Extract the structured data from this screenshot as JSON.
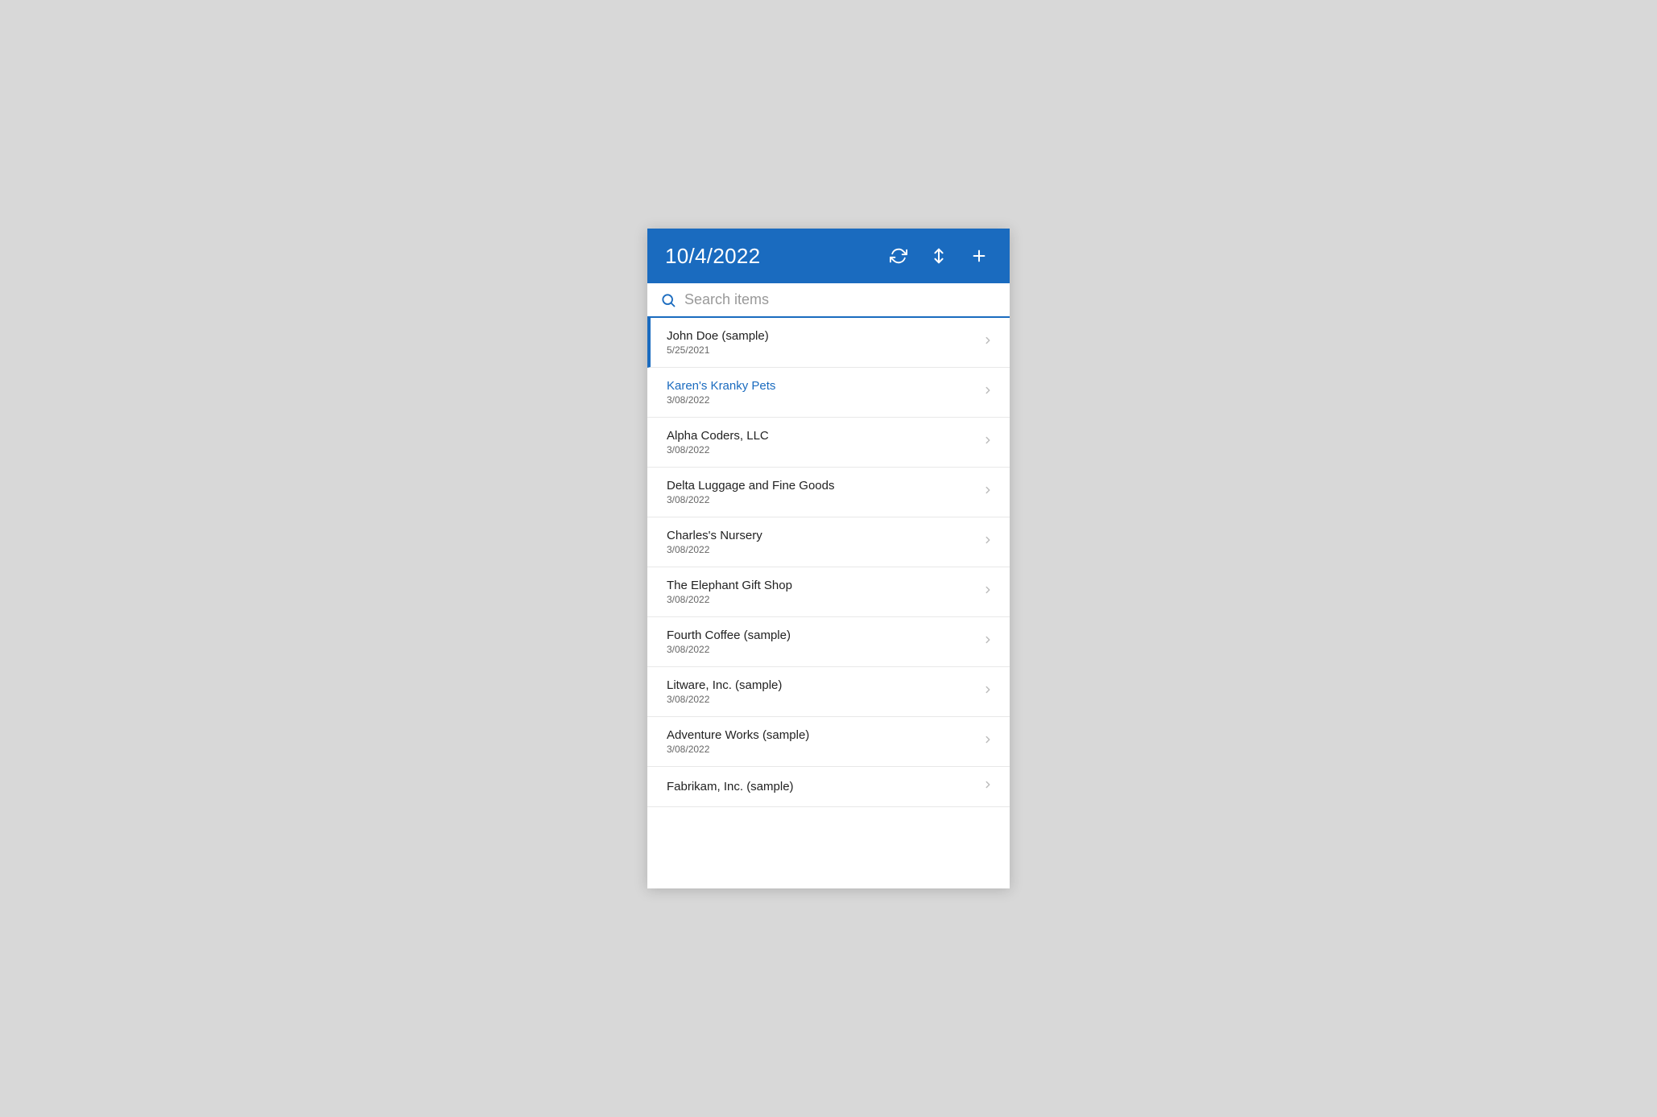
{
  "header": {
    "title": "10/4/2022",
    "refresh_icon": "↺",
    "sort_icon": "⇅",
    "add_icon": "+"
  },
  "search": {
    "placeholder": "Search items"
  },
  "colors": {
    "brand_blue": "#1a6bbf",
    "link_blue": "#1a6bbf"
  },
  "items": [
    {
      "id": 1,
      "name": "John Doe (sample)",
      "date": "5/25/2021",
      "selected": true,
      "link": false
    },
    {
      "id": 2,
      "name": "Karen's Kranky Pets",
      "date": "3/08/2022",
      "selected": false,
      "link": true
    },
    {
      "id": 3,
      "name": "Alpha Coders, LLC",
      "date": "3/08/2022",
      "selected": false,
      "link": false
    },
    {
      "id": 4,
      "name": "Delta Luggage and Fine Goods",
      "date": "3/08/2022",
      "selected": false,
      "link": false
    },
    {
      "id": 5,
      "name": "Charles's Nursery",
      "date": "3/08/2022",
      "selected": false,
      "link": false
    },
    {
      "id": 6,
      "name": "The Elephant Gift Shop",
      "date": "3/08/2022",
      "selected": false,
      "link": false
    },
    {
      "id": 7,
      "name": "Fourth Coffee (sample)",
      "date": "3/08/2022",
      "selected": false,
      "link": false
    },
    {
      "id": 8,
      "name": "Litware, Inc. (sample)",
      "date": "3/08/2022",
      "selected": false,
      "link": false
    },
    {
      "id": 9,
      "name": "Adventure Works (sample)",
      "date": "3/08/2022",
      "selected": false,
      "link": false
    }
  ],
  "partial_item": {
    "name": "Fabrikam, Inc. (sample)"
  }
}
